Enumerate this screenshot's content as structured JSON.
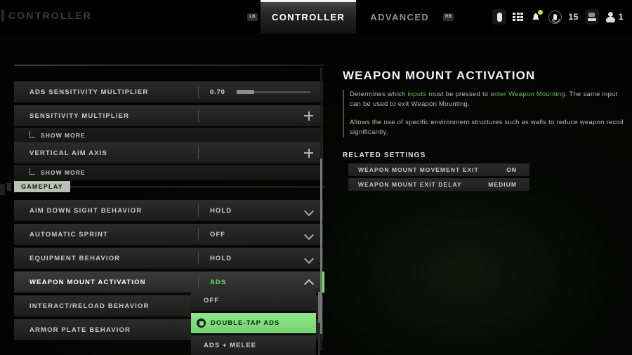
{
  "app": {
    "title": "CONTROLLER"
  },
  "header": {
    "left_bumper": "LB",
    "right_bumper": "RB",
    "tabs": [
      {
        "label": "CONTROLLER",
        "active": true
      },
      {
        "label": "ADVANCED",
        "active": false
      }
    ],
    "status": {
      "battery_icon": "battery-icon",
      "apps_icon": "apps-grid-icon",
      "notifications_icon": "bell-icon",
      "mic_icon": "microphone-icon",
      "friends_count": "15",
      "console_icon": "console-icon",
      "party_icon": "party-icon",
      "party_count": "1"
    }
  },
  "settings": {
    "rows": [
      {
        "label": "ADS SENSITIVITY MULTIPLIER",
        "type": "slider",
        "value": "0.70",
        "fill_percent": 24
      },
      {
        "label": "SENSITIVITY MULTIPLIER",
        "type": "expand",
        "value": ""
      },
      {
        "label": "VERTICAL AIM AXIS",
        "type": "expand",
        "value": ""
      }
    ],
    "show_more_label": "SHOW MORE",
    "section": {
      "label": "GAMEPLAY"
    },
    "gameplay_rows": [
      {
        "label": "AIM DOWN SIGHT BEHAVIOR",
        "value": "HOLD",
        "selected": false
      },
      {
        "label": "AUTOMATIC SPRINT",
        "value": "OFF",
        "selected": false
      },
      {
        "label": "EQUIPMENT BEHAVIOR",
        "value": "HOLD",
        "selected": false
      },
      {
        "label": "WEAPON MOUNT ACTIVATION",
        "value": "ADS",
        "selected": true
      },
      {
        "label": "INTERACT/RELOAD BEHAVIOR",
        "value": "",
        "selected": false
      },
      {
        "label": "ARMOR PLATE BEHAVIOR",
        "value": "",
        "selected": false
      }
    ]
  },
  "dropdown": {
    "open": true,
    "options": [
      {
        "label": "OFF",
        "highlight": false
      },
      {
        "label": "DOUBLE-TAP ADS",
        "highlight": true
      },
      {
        "label": "ADS + MELEE",
        "highlight": false
      }
    ]
  },
  "detail": {
    "title": "WEAPON MOUNT ACTIVATION",
    "paragraph_1_a": "Determines which ",
    "paragraph_1_hl1": "inputs",
    "paragraph_1_b": " must be pressed to ",
    "paragraph_1_hl2": "enter Weapon Mounting",
    "paragraph_1_c": ". The same input can be used to exit Weapon Mounting.",
    "paragraph_2": "Allows the use of specific environment structures such as walls to reduce weapon recoil significantly.",
    "related_title": "RELATED SETTINGS",
    "related": [
      {
        "label": "WEAPON MOUNT MOVEMENT EXIT",
        "value": "ON"
      },
      {
        "label": "WEAPON MOUNT EXIT DELAY",
        "value": "MEDIUM"
      }
    ]
  },
  "colors": {
    "accent_green": "#74e36b",
    "highlight_green": "#8fe58b",
    "section_chip": "#b9c2b2"
  }
}
